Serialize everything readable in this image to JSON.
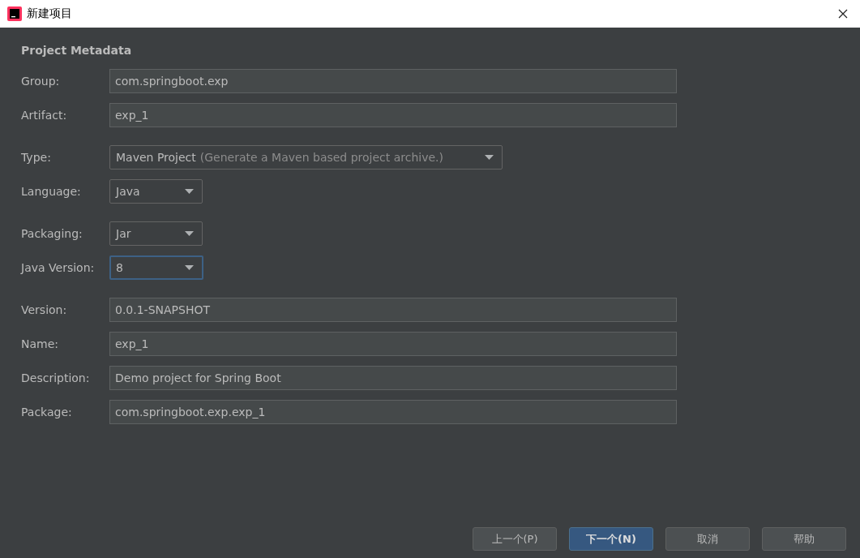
{
  "window": {
    "title": "新建项目"
  },
  "section_title": "Project Metadata",
  "field_groups": [
    {
      "fields": [
        {
          "kind": "text",
          "label": "Group:",
          "value": "com.springboot.exp"
        },
        {
          "kind": "text",
          "label": "Artifact:",
          "value": "exp_1"
        }
      ]
    },
    {
      "fields": [
        {
          "kind": "dropdown",
          "label": "Type:",
          "value": "Maven Project",
          "hint": "(Generate a Maven based project archive.)",
          "focused": false
        },
        {
          "kind": "dropdown",
          "label": "Language:",
          "value": "Java",
          "focused": false
        }
      ]
    },
    {
      "fields": [
        {
          "kind": "dropdown",
          "label": "Packaging:",
          "value": "Jar",
          "focused": false
        },
        {
          "kind": "dropdown",
          "label": "Java Version:",
          "value": "8",
          "focused": true
        }
      ]
    },
    {
      "fields": [
        {
          "kind": "text",
          "label": "Version:",
          "value": "0.0.1-SNAPSHOT"
        },
        {
          "kind": "text",
          "label": "Name:",
          "value": "exp_1"
        },
        {
          "kind": "text",
          "label": "Description:",
          "value": "Demo project for Spring Boot"
        },
        {
          "kind": "text",
          "label": "Package:",
          "value": "com.springboot.exp.exp_1"
        }
      ]
    }
  ],
  "buttons": [
    {
      "label": "上一个(P)",
      "primary": false
    },
    {
      "label": "下一个(N)",
      "primary": true
    },
    {
      "label": "取消",
      "primary": false
    },
    {
      "label": "帮助",
      "primary": false
    }
  ]
}
